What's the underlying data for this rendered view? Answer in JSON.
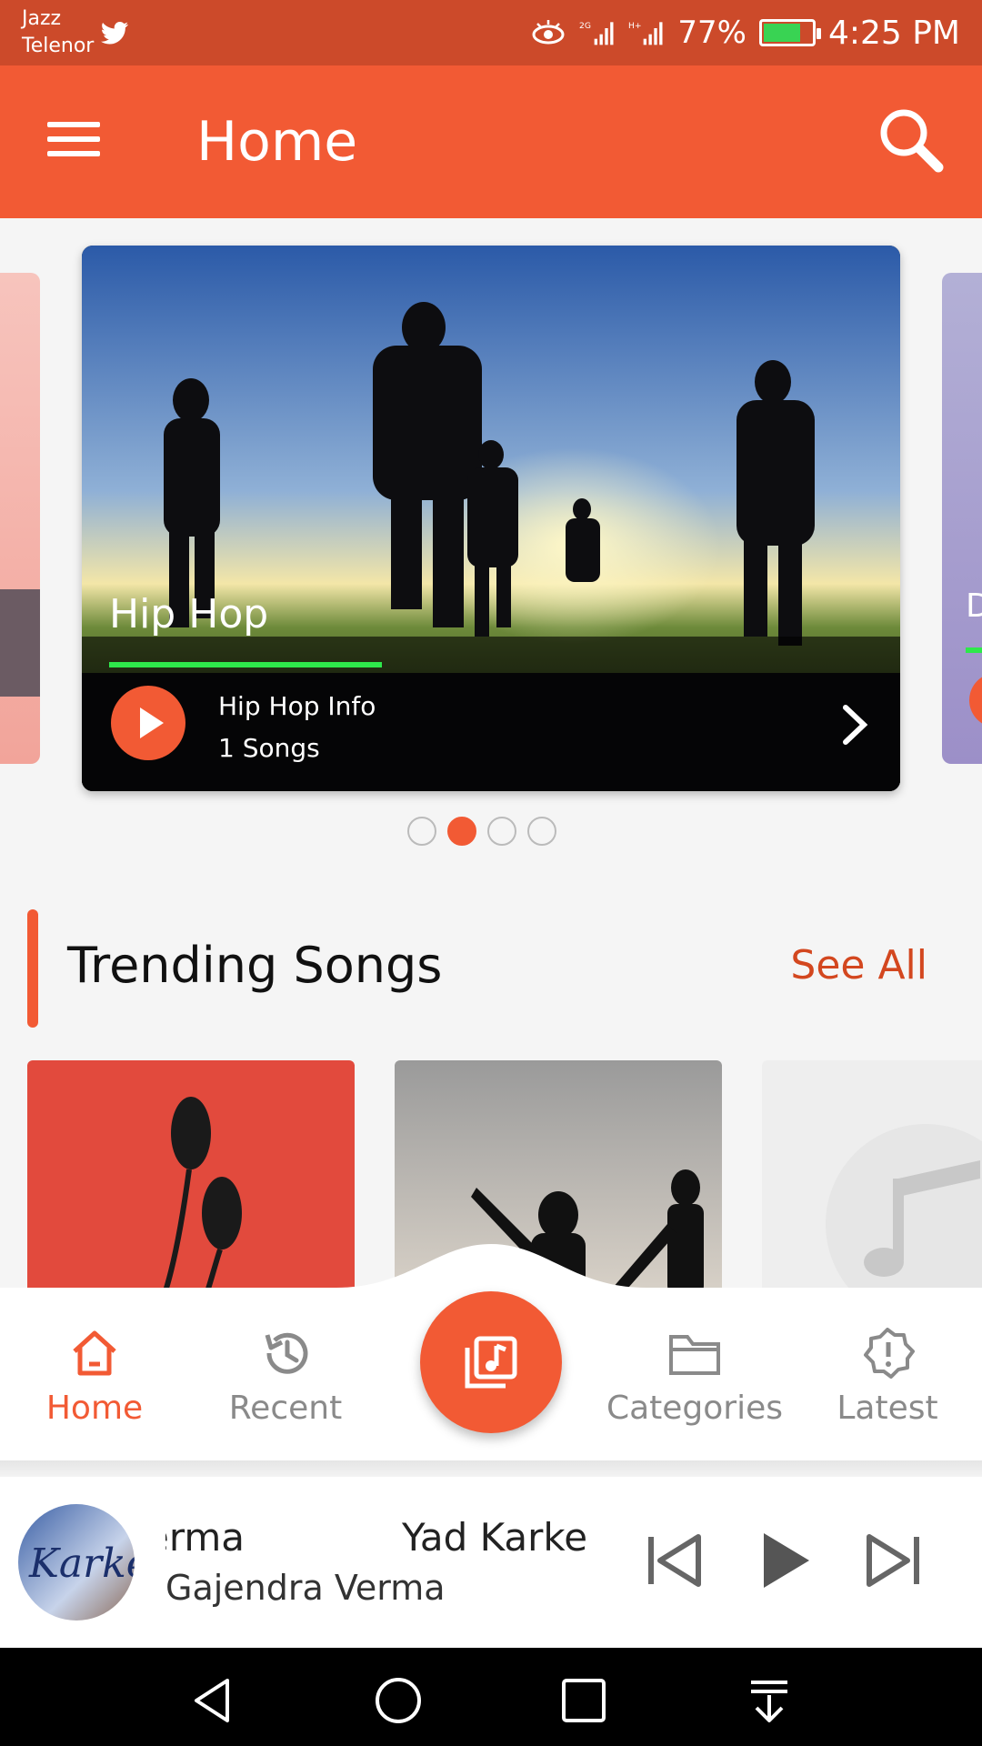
{
  "status_bar": {
    "carrier_1": "Jazz",
    "carrier_2": "Telenor",
    "network_1": "2G",
    "network_2": "H+",
    "battery": "77%",
    "battery_level": 0.77,
    "time": "4:25 PM"
  },
  "app_bar": {
    "title": "Home",
    "menu_icon": "hamburger-menu-icon",
    "search_icon": "search-icon"
  },
  "carousel": {
    "active_slide": {
      "title": "Hip Hop",
      "info": "Hip Hop Info",
      "count": "1 Songs"
    },
    "right_peek_letter": "D",
    "dots": [
      false,
      true,
      false,
      false
    ]
  },
  "trending": {
    "title": "Trending Songs",
    "see_all": "See All"
  },
  "bottom_nav": {
    "items": [
      {
        "label": "Home",
        "icon": "home-icon",
        "active": true
      },
      {
        "label": "Recent",
        "icon": "history-icon",
        "active": false
      },
      {
        "label": "Categories",
        "icon": "folder-icon",
        "active": false
      },
      {
        "label": "Latest",
        "icon": "new-badge-icon",
        "active": false
      }
    ],
    "fab_icon": "music-library-icon"
  },
  "player": {
    "album_art_text": "Karke",
    "track_title_tail": "erma",
    "track_title": "Yad Karke",
    "artist": "Gajendra Verma"
  },
  "colors": {
    "accent": "#f25a34",
    "status_bar": "#cc4a2a",
    "progress_green": "#2ee84b"
  }
}
